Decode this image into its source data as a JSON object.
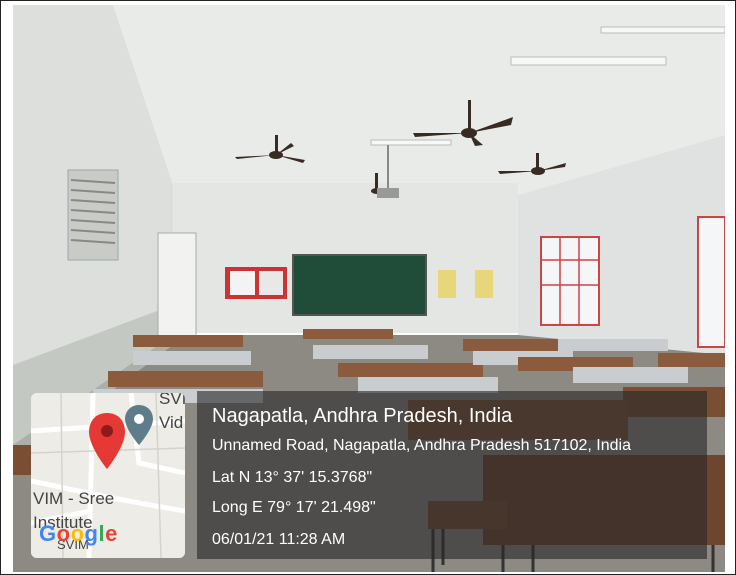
{
  "location": {
    "title": "Nagapatla, Andhra Pradesh, India",
    "address": "Unnamed Road, Nagapatla, Andhra Pradesh 517102, India",
    "latitude": "Lat N 13° 37' 15.3768\"",
    "longitude": "Long E 79° 17' 21.498\"",
    "datetime": "06/01/21 11:28 AM"
  },
  "map": {
    "labels": [
      "SVI",
      "Vid",
      "VIM - Sree",
      "Institute",
      "SVIM"
    ],
    "logo": [
      "G",
      "o",
      "o",
      "g",
      "l",
      "e"
    ],
    "logo_colors": [
      "#4285F4",
      "#EA4335",
      "#FBBC05",
      "#4285F4",
      "#34A853",
      "#EA4335"
    ],
    "pin_color": "#E53935",
    "secondary_pin_color": "#5F7C8A"
  },
  "icons": [
    "map-pin-icon",
    "place-pin-icon"
  ]
}
